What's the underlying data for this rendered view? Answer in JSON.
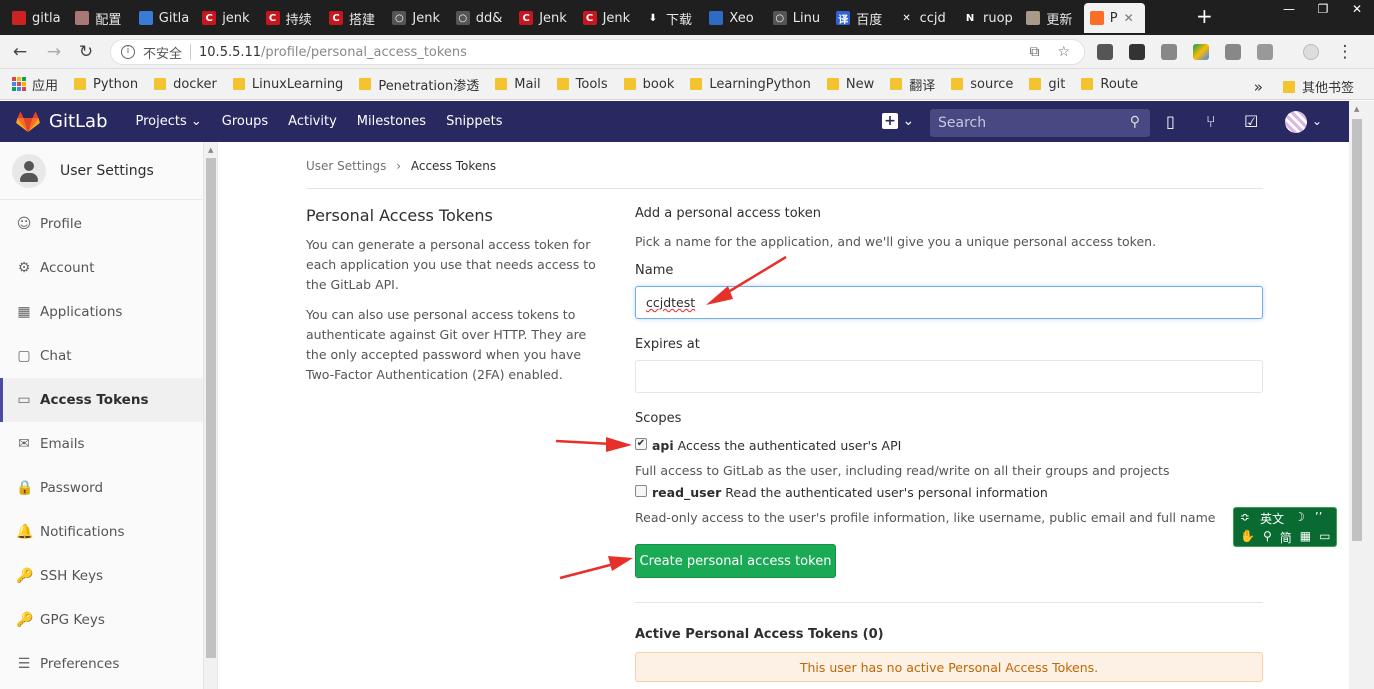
{
  "browser": {
    "tabs": [
      {
        "label": "gitla",
        "icon": "red-circle-icon"
      },
      {
        "label": "配置",
        "icon": "gear-favicon-icon"
      },
      {
        "label": "Gitla",
        "icon": "pen-favicon-icon"
      },
      {
        "label": "jenk",
        "icon": "csdn-icon"
      },
      {
        "label": "持续",
        "icon": "csdn-icon"
      },
      {
        "label": "搭建",
        "icon": "csdn-icon"
      },
      {
        "label": "Jenk",
        "icon": "github-icon"
      },
      {
        "label": "dd&",
        "icon": "github-icon"
      },
      {
        "label": "Jenk",
        "icon": "csdn-icon"
      },
      {
        "label": "Jenk",
        "icon": "csdn-icon"
      },
      {
        "label": "下载",
        "icon": "download-icon"
      },
      {
        "label": "Xeo",
        "icon": "blue-favicon-icon"
      },
      {
        "label": "Linu",
        "icon": "github-icon"
      },
      {
        "label": "百度",
        "icon": "translate-icon"
      },
      {
        "label": "ccjd",
        "icon": "x-favicon-icon"
      },
      {
        "label": "ruop",
        "icon": "n-favicon-icon"
      },
      {
        "label": "更新",
        "icon": "avatar-favicon-icon"
      },
      {
        "label": "P",
        "icon": "gitlab-favicon-icon"
      }
    ],
    "insecure_label": "不安全",
    "url_host": "10.5.5.11",
    "url_path": "/profile/personal_access_tokens",
    "bookmarks": [
      {
        "label": "应用",
        "type": "apps"
      },
      {
        "label": "Python",
        "type": "folder"
      },
      {
        "label": "docker",
        "type": "folder"
      },
      {
        "label": "LinuxLearning",
        "type": "folder"
      },
      {
        "label": "Penetration渗透",
        "type": "folder"
      },
      {
        "label": "Mail",
        "type": "folder"
      },
      {
        "label": "Tools",
        "type": "folder"
      },
      {
        "label": "book",
        "type": "folder"
      },
      {
        "label": "LearningPython",
        "type": "folder"
      },
      {
        "label": "New",
        "type": "folder"
      },
      {
        "label": "翻译",
        "type": "folder"
      },
      {
        "label": "source",
        "type": "folder"
      },
      {
        "label": "git",
        "type": "folder"
      },
      {
        "label": "Route",
        "type": "folder"
      }
    ],
    "more_bookmarks": "»",
    "other_bookmarks": "其他书签"
  },
  "gitlab": {
    "brand": "GitLab",
    "nav": [
      "Projects",
      "Groups",
      "Activity",
      "Milestones",
      "Snippets"
    ],
    "search_placeholder": "Search",
    "header_color": "#292961"
  },
  "sidebar": {
    "title": "User Settings",
    "items": [
      {
        "label": "Profile",
        "icon": "profile-icon",
        "glyph": "☺"
      },
      {
        "label": "Account",
        "icon": "account-gear-icon",
        "glyph": "⚙"
      },
      {
        "label": "Applications",
        "icon": "applications-grid-icon",
        "glyph": "▦"
      },
      {
        "label": "Chat",
        "icon": "chat-bubble-icon",
        "glyph": "▢"
      },
      {
        "label": "Access Tokens",
        "icon": "token-icon",
        "glyph": "▭"
      },
      {
        "label": "Emails",
        "icon": "envelope-icon",
        "glyph": "✉"
      },
      {
        "label": "Password",
        "icon": "lock-icon",
        "glyph": "🔒"
      },
      {
        "label": "Notifications",
        "icon": "bell-icon",
        "glyph": "🔔"
      },
      {
        "label": "SSH Keys",
        "icon": "key-icon",
        "glyph": "🔑"
      },
      {
        "label": "GPG Keys",
        "icon": "key-icon",
        "glyph": "🔑"
      },
      {
        "label": "Preferences",
        "icon": "sliders-icon",
        "glyph": "☰"
      }
    ],
    "active_index": 4
  },
  "breadcrumb": {
    "parent": "User Settings",
    "sep": "›",
    "current": "Access Tokens"
  },
  "left_panel": {
    "title": "Personal Access Tokens",
    "para1": "You can generate a personal access token for each application you use that needs access to the GitLab API.",
    "para2": "You can also use personal access tokens to authenticate against Git over HTTP. They are the only accepted password when you have Two-Factor Authentication (2FA) enabled."
  },
  "form": {
    "heading": "Add a personal access token",
    "subtext": "Pick a name for the application, and we'll give you a unique personal access token.",
    "name_label": "Name",
    "name_value": "ccjdtest",
    "expires_label": "Expires at",
    "expires_value": "",
    "scopes_label": "Scopes",
    "scopes": [
      {
        "key": "api",
        "label": "Access the authenticated user's API",
        "checked": true,
        "desc": "Full access to GitLab as the user, including read/write on all their groups and projects"
      },
      {
        "key": "read_user",
        "label": "Read the authenticated user's personal information",
        "checked": false,
        "desc": "Read-only access to the user's profile information, like username, public email and full name"
      }
    ],
    "submit_label": "Create personal access token",
    "submit_color": "#1aaa55"
  },
  "active_tokens": {
    "heading": "Active Personal Access Tokens (0)",
    "empty_message": "This user has no active Personal Access Tokens."
  },
  "ime": {
    "row1": [
      "英文"
    ],
    "row2": [
      "简",
      "简"
    ],
    "lang": "英文",
    "mode": "简"
  },
  "annotation_color": "#e8302a"
}
